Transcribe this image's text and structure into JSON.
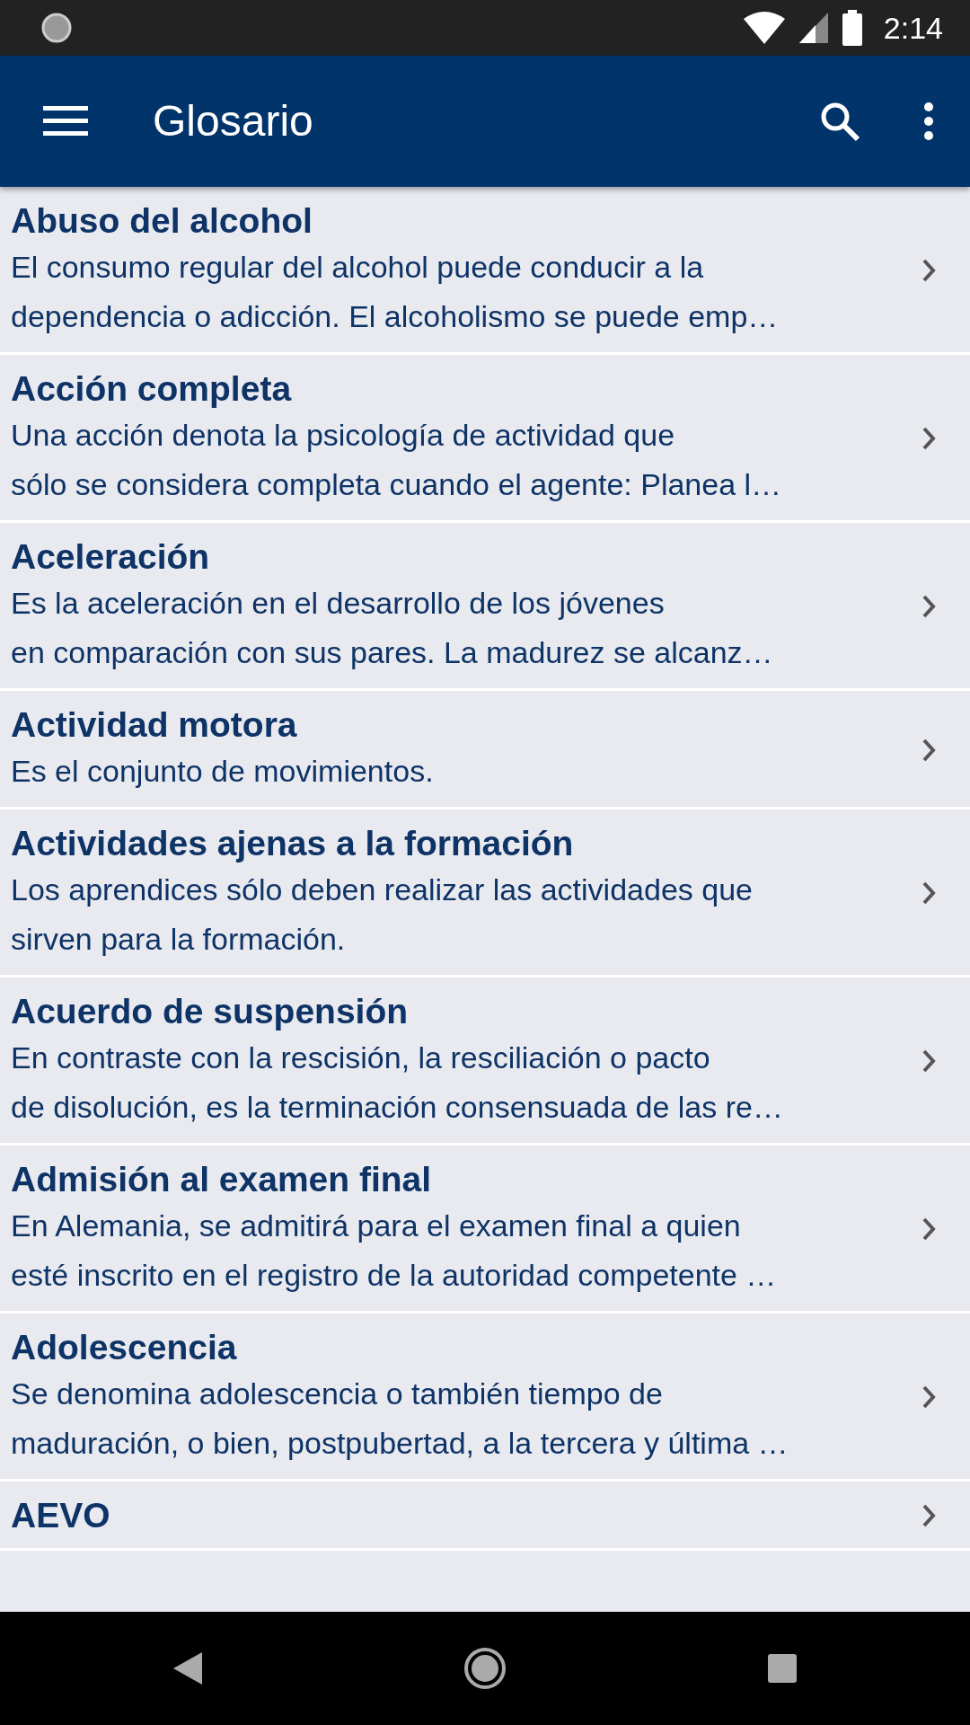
{
  "status_bar": {
    "time": "2:14"
  },
  "app_bar": {
    "title": "Glosario"
  },
  "entries": [
    {
      "term": "Abuso del alcohol",
      "description": "El consumo regular del alcohol puede conducir a la\ndependencia o adicción. El alcoholismo se puede emp…"
    },
    {
      "term": "Acción completa",
      "description": "Una acción denota la psicología de actividad que\nsólo se considera completa cuando el agente: Planea l…"
    },
    {
      "term": "Aceleración",
      "description": "Es la aceleración en el desarrollo de los jóvenes\nen comparación con sus pares. La madurez se alcanz…"
    },
    {
      "term": "Actividad motora",
      "description": "Es el conjunto de movimientos."
    },
    {
      "term": "Actividades ajenas a la formación",
      "description": "Los aprendices sólo deben realizar las actividades que\nsirven para la formación."
    },
    {
      "term": "Acuerdo de suspensión",
      "description": "En contraste con la rescisión, la resciliación o pacto\nde disolución, es la terminación consensuada de las re…"
    },
    {
      "term": "Admisión al examen final",
      "description": "En Alemania, se admitirá para el examen final a quien\nesté inscrito en el registro de la autoridad competente …"
    },
    {
      "term": "Adolescencia",
      "description": "Se denomina adolescencia o también tiempo de\nmaduración, o bien, postpubertad, a la tercera y última …"
    },
    {
      "term": "AEVO"
    }
  ]
}
